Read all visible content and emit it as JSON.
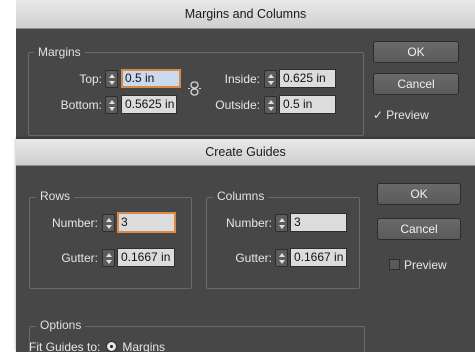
{
  "margins_dialog": {
    "title": "Margins and Columns",
    "margins_legend": "Margins",
    "top_label": "Top:",
    "top_value": "0.5 in",
    "bottom_label": "Bottom:",
    "bottom_value": "0.5625 in",
    "inside_label": "Inside:",
    "inside_value": "0.625 in",
    "outside_label": "Outside:",
    "outside_value": "0.5 in",
    "ok_label": "OK",
    "cancel_label": "Cancel",
    "preview_label": "Preview",
    "preview_checked": true
  },
  "guides_dialog": {
    "title": "Create Guides",
    "rows_legend": "Rows",
    "rows_number_label": "Number:",
    "rows_number_value": "3",
    "rows_gutter_label": "Gutter:",
    "rows_gutter_value": "0.1667 in",
    "columns_legend": "Columns",
    "columns_number_label": "Number:",
    "columns_number_value": "3",
    "columns_gutter_label": "Gutter:",
    "columns_gutter_value": "0.1667 in",
    "ok_label": "OK",
    "cancel_label": "Cancel",
    "preview_label": "Preview",
    "preview_checked": false,
    "options_legend": "Options",
    "fit_guides_label": "Fit Guides to:",
    "fit_guides_option": "Margins"
  },
  "colors": {
    "dialog_bg": "#474747",
    "focus_ring": "#d98a46",
    "field_bg": "#dcdcdc"
  }
}
